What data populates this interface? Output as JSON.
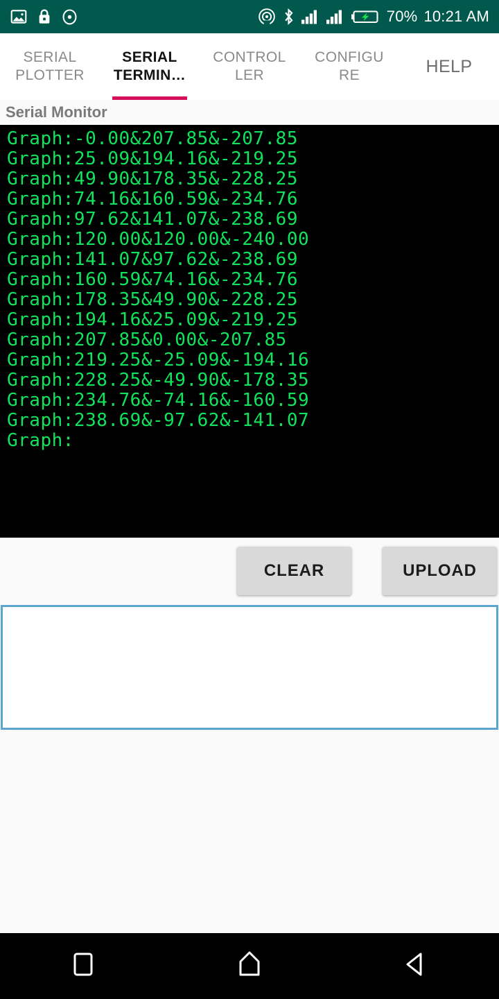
{
  "status_bar": {
    "left_icons": [
      "image-icon",
      "lock-icon",
      "record-circle-icon"
    ],
    "right_icons": [
      "hotspot-icon",
      "bluetooth-icon",
      "signal-bars-sim1-icon",
      "signal-bars-sim2-icon",
      "battery-charging-icon"
    ],
    "battery_percent": "70%",
    "clock": "10:21 AM",
    "background_color": "#00594C"
  },
  "tabs": [
    {
      "label": "SERIAL PLOTTER",
      "active": false
    },
    {
      "label": "SERIAL TERMIN…",
      "active": true
    },
    {
      "label": "CONTROL LER",
      "active": false
    },
    {
      "label": "CONFIGU RE",
      "active": false
    },
    {
      "label": "HELP",
      "active": false
    }
  ],
  "tab_accent_color": "#D6105A",
  "monitor": {
    "title": "Serial Monitor",
    "text_color": "#12E35C",
    "background_color": "#000000",
    "lines": [
      "Graph:-0.00&207.85&-207.85",
      "Graph:25.09&194.16&-219.25",
      "Graph:49.90&178.35&-228.25",
      "Graph:74.16&160.59&-234.76",
      "Graph:97.62&141.07&-238.69",
      "Graph:120.00&120.00&-240.00",
      "Graph:141.07&97.62&-238.69",
      "Graph:160.59&74.16&-234.76",
      "Graph:178.35&49.90&-228.25",
      "Graph:194.16&25.09&-219.25",
      "Graph:207.85&0.00&-207.85",
      "Graph:219.25&-25.09&-194.16",
      "Graph:228.25&-49.90&-178.35",
      "Graph:234.76&-74.16&-160.59",
      "Graph:238.69&-97.62&-141.07",
      "Graph:"
    ]
  },
  "actions": {
    "clear_label": "CLEAR",
    "upload_label": "UPLOAD"
  },
  "send_input": {
    "value": "",
    "placeholder": "",
    "border_color": "#5BA3D0"
  },
  "nav_bar": {
    "recents_icon": "square-recents-icon",
    "home_icon": "home-icon",
    "back_icon": "back-triangle-icon"
  }
}
